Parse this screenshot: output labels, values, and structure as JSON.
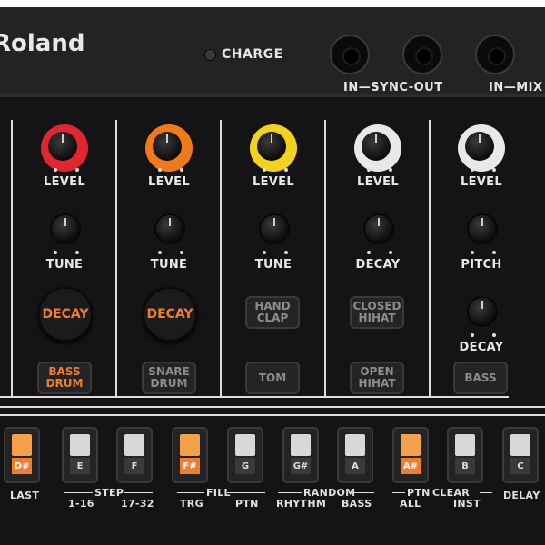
{
  "header": {
    "logo": "Roland",
    "charge_label": "CHARGE",
    "sync_label": "IN—SYNC-OUT",
    "mix_label": "IN—MIX"
  },
  "colors": {
    "ring_red": "#e0262e",
    "ring_orange": "#f07a1a",
    "ring_yellow": "#f2d21c",
    "ring_white": "#e8e8e8",
    "accent_orange": "#f07e2c"
  },
  "channels": [
    {
      "level_label": "LEVEL",
      "knob2_label": "TUNE",
      "decay_label": "DECAY",
      "button_label": "BASS DRUM"
    },
    {
      "level_label": "LEVEL",
      "knob2_label": "TUNE",
      "decay_label": "DECAY",
      "button_label": "SNARE DRUM"
    },
    {
      "level_label": "LEVEL",
      "knob2_label": "TUNE",
      "mid_button": "HAND CLAP",
      "button_label": "TOM"
    },
    {
      "level_label": "LEVEL",
      "knob2_label": "DECAY",
      "mid_button": "CLOSED HIHAT",
      "button_label": "OPEN HIHAT"
    },
    {
      "level_label": "LEVEL",
      "knob2_label": "PITCH",
      "knob3_label": "DECAY",
      "button_label": "BASS"
    }
  ],
  "steps": [
    {
      "note": "D#",
      "lit": true
    },
    {
      "note": "E",
      "lit": false
    },
    {
      "note": "F",
      "lit": false
    },
    {
      "note": "F#",
      "lit": true
    },
    {
      "note": "G",
      "lit": false
    },
    {
      "note": "G#",
      "lit": false
    },
    {
      "note": "A",
      "lit": false
    },
    {
      "note": "A#",
      "lit": true
    },
    {
      "note": "B",
      "lit": false
    },
    {
      "note": "C",
      "lit": false
    }
  ],
  "bottom_labels": {
    "last": "LAST",
    "step": "STEP",
    "step_1_16": "1-16",
    "step_17_32": "17-32",
    "fill": "FILL",
    "trg": "TRG",
    "ptn": "PTN",
    "random": "RANDOM",
    "rhythm": "RHYTHM",
    "bass": "BASS",
    "ptn_clear": "PTN",
    "clear": "CLEAR",
    "all": "ALL",
    "inst": "INST",
    "delay": "DELAY"
  }
}
